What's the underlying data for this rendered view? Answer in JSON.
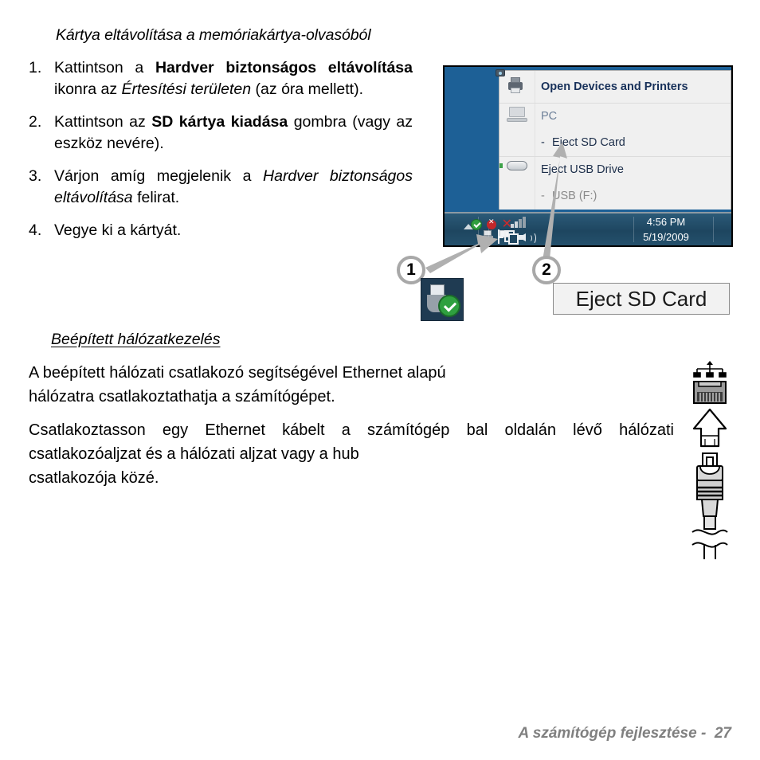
{
  "heading": "Kártya eltávolítása a memóriakártya-olvasóból",
  "steps": [
    {
      "num": "1.",
      "segments": [
        {
          "text": "Kattintson a ",
          "style": "normal"
        },
        {
          "text": "Hardver biztonságos eltávolítása",
          "style": "bold"
        },
        {
          "text": " ikonra az ",
          "style": "normal"
        },
        {
          "text": "Értesítési területen",
          "style": "italic"
        },
        {
          "text": " (az óra mellett).",
          "style": "normal"
        }
      ]
    },
    {
      "num": "2.",
      "segments": [
        {
          "text": "Kattintson az ",
          "style": "normal"
        },
        {
          "text": "SD kártya kiadása",
          "style": "bold"
        },
        {
          "text": " gombra (vagy az eszköz nevére).",
          "style": "normal"
        }
      ]
    },
    {
      "num": "3.",
      "segments": [
        {
          "text": "Várjon amíg megjelenik a ",
          "style": "normal"
        },
        {
          "text": "Hardver biztonságos eltávolítása",
          "style": "italic"
        },
        {
          "text": " felirat.",
          "style": "normal"
        }
      ]
    },
    {
      "num": "4.",
      "segments": [
        {
          "text": "Vegye ki a kártyát.",
          "style": "normal"
        }
      ]
    }
  ],
  "subheading": "Beépített hálózatkezelés",
  "paragraphs": {
    "p1_main": "A beépített hálózati csatlakozó segítségével Ethernet alapú",
    "p1_last": "hálózatra csatlakoztathatja a számítógépet.",
    "p2_main": "Csatlakoztasson egy Ethernet kábelt a számítógép bal oldalán lévő hálózati csatlakozóaljzat és a hálózati aljzat vagy a hub",
    "p2_last": "csatlakozója közé."
  },
  "footer": "A számítógép fejlesztése -  27",
  "screenshot": {
    "menu": {
      "title": "Open Devices and Printers",
      "groups": [
        {
          "label": "PC",
          "label_style": "muted",
          "items": [
            {
              "dash": "-",
              "label": "Eject SD Card",
              "style": "dark"
            }
          ]
        },
        {
          "label": "Eject USB Drive",
          "label_style": "dark",
          "items": [
            {
              "dash": "-",
              "label": "USB (F:)",
              "style": "muted"
            }
          ]
        }
      ],
      "icons": [
        "printer-icon",
        "laptop-icon",
        "usb-drive-icon"
      ]
    },
    "taskbar": {
      "tray_icons": [
        "safely-remove-hardware-icon",
        "action-center-flag-icon",
        "plug-device-icon",
        "network-signal-icon",
        "volume-speaker-icon"
      ],
      "time": "4:56 PM",
      "date": "5/19/2009"
    },
    "colors": {
      "desktop": "#1d6096",
      "taskbar": "#1e4660",
      "menu_bg": "#f0f0f0",
      "menu_title": "#18315a",
      "menu_muted": "#6d8099"
    }
  },
  "callouts": [
    {
      "id": "1",
      "label": "1"
    },
    {
      "id": "2",
      "label": "2"
    }
  ],
  "zoom_label": "Eject SD Card",
  "ethernet_illustration": {
    "parts": [
      "network-symbol-icon",
      "rj45-port-icon",
      "up-arrow-icon",
      "rj45-plug-icon",
      "cable-break-icon"
    ]
  }
}
